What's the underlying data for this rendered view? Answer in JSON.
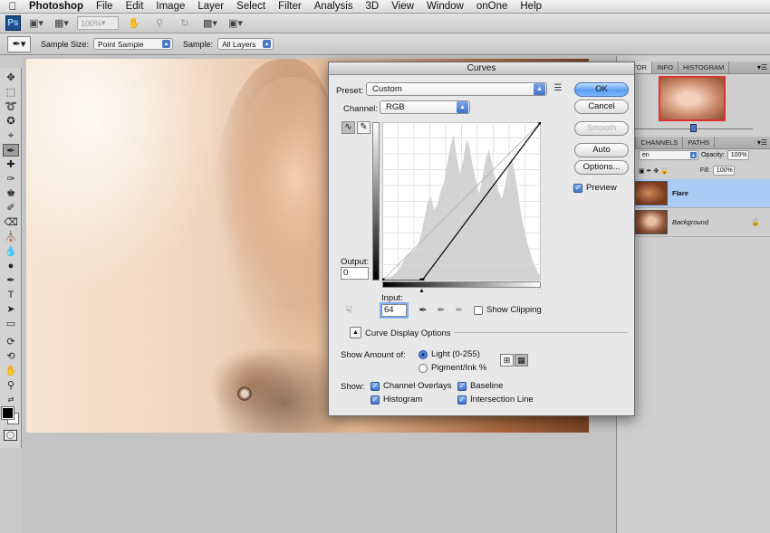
{
  "menubar": {
    "app_name": "Photoshop",
    "items": [
      "File",
      "Edit",
      "Image",
      "Layer",
      "Select",
      "Filter",
      "Analysis",
      "3D",
      "View",
      "Window",
      "onOne",
      "Help"
    ]
  },
  "appbar": {
    "logo": "Ps",
    "zoom": "100%"
  },
  "options": {
    "sample_size_label": "Sample Size:",
    "sample_size_value": "Point Sample",
    "sample_label": "Sample:",
    "sample_value": "All Layers"
  },
  "panels": {
    "top_tabs": [
      "IGATOR",
      "INFO",
      "HISTOGRAM"
    ],
    "layer_tabs": [
      "RS",
      "CHANNELS",
      "PATHS"
    ],
    "blend_mode": "en",
    "opacity_label": "Opacity:",
    "opacity_value": "100%",
    "fill_label": "Fill:",
    "fill_value": "100%",
    "layers": [
      {
        "name": "Flare",
        "selected": true
      },
      {
        "name": "Background",
        "selected": false
      }
    ]
  },
  "curves": {
    "title": "Curves",
    "preset_label": "Preset:",
    "preset_value": "Custom",
    "channel_label": "Channel:",
    "channel_value": "RGB",
    "output_label": "Output:",
    "output_value": "0",
    "input_label": "Input:",
    "input_value": "64",
    "show_clipping": "Show Clipping",
    "curve_display_options": "Curve Display Options",
    "show_amount_label": "Show Amount of:",
    "light_option": "Light  (0-255)",
    "pigment_option": "Pigment/Ink %",
    "show_label": "Show:",
    "channel_overlays": "Channel Overlays",
    "baseline": "Baseline",
    "histogram": "Histogram",
    "intersection_line": "Intersection Line",
    "buttons": {
      "ok": "OK",
      "cancel": "Cancel",
      "smooth": "Smooth",
      "auto": "Auto",
      "options": "Options..."
    },
    "preview_label": "Preview",
    "curve_points": [
      [
        0,
        0
      ],
      [
        64,
        0
      ],
      [
        255,
        255
      ]
    ],
    "colors": {
      "accent": "#3f74cf",
      "histogram": "#d2d2d2"
    }
  }
}
